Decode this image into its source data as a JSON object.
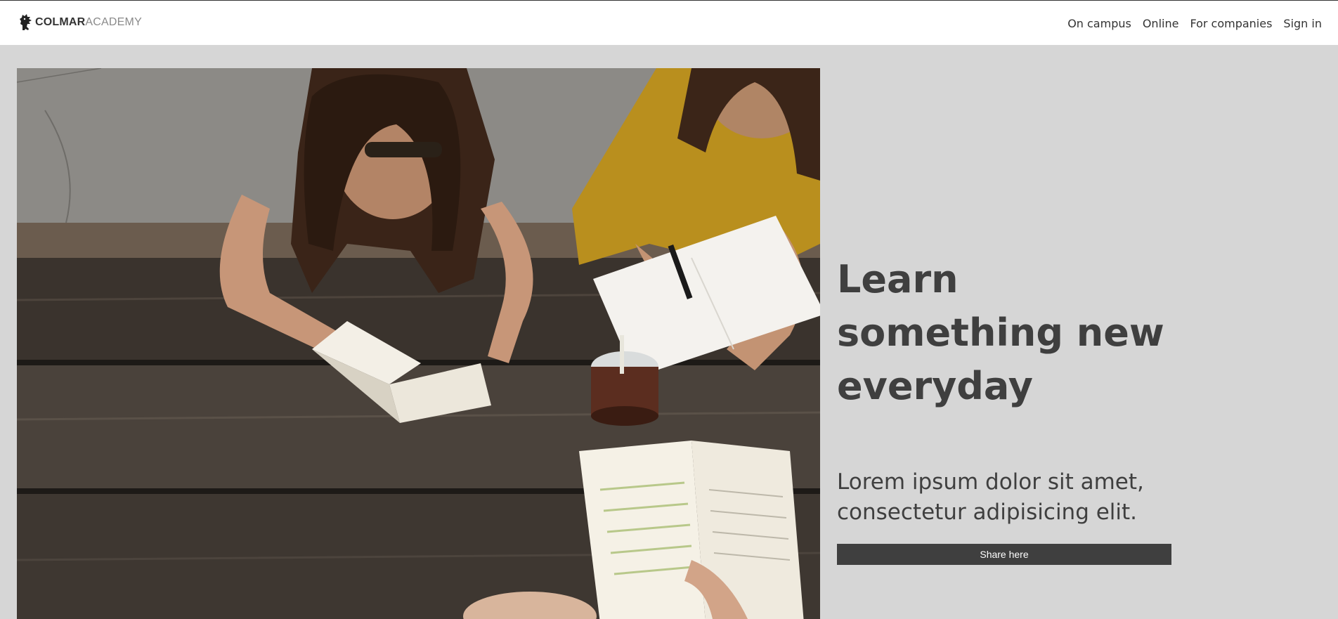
{
  "header": {
    "logo_bold": "COLMAR",
    "logo_light": "ACADEMY",
    "nav": [
      "On campus",
      "Online",
      "For companies",
      "Sign in"
    ]
  },
  "hero": {
    "image_icon": "students-studying-photo",
    "headline": "Learn something new everyday",
    "subtext": "Lorem ipsum dolor sit amet, consectetur adipisicing elit.",
    "button_label": "Share here"
  },
  "colors": {
    "background": "#d6d6d6",
    "header_bg": "#ffffff",
    "text": "#3f3f3f",
    "button_bg": "#3f3f3f",
    "button_text": "#ffffff"
  }
}
